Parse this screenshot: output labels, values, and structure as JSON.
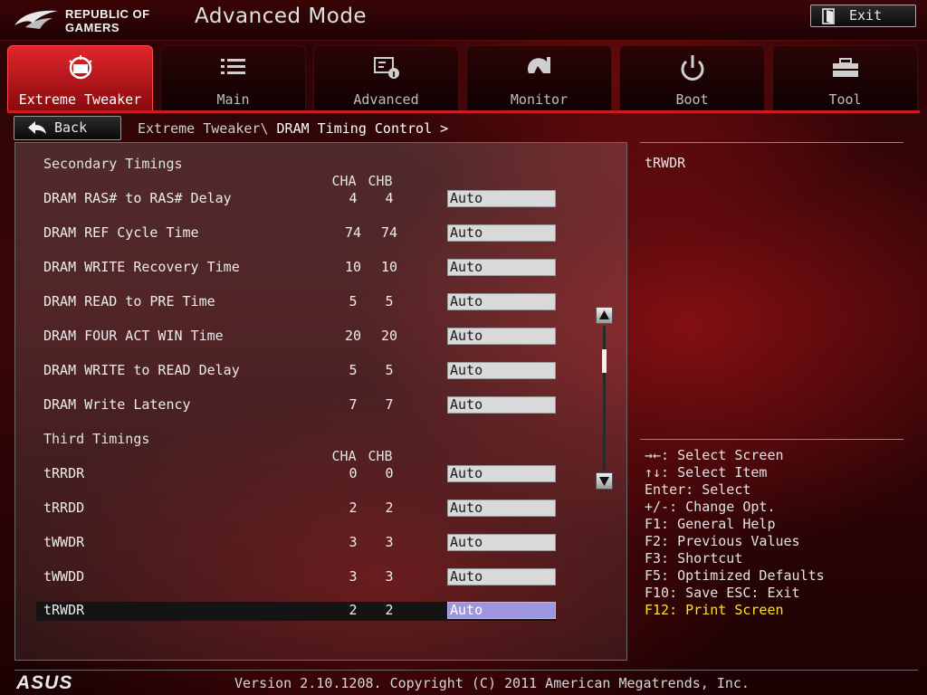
{
  "header": {
    "logo_line1": "REPUBLIC OF",
    "logo_line2": "GAMERS",
    "mode_title": "Advanced Mode",
    "exit_label": "Exit"
  },
  "tabs": [
    {
      "label": "Extreme Tweaker",
      "icon": "extreme-tweaker-icon",
      "active": true
    },
    {
      "label": "Main",
      "icon": "list-icon",
      "active": false
    },
    {
      "label": "Advanced",
      "icon": "advanced-settings-icon",
      "active": false
    },
    {
      "label": "Monitor",
      "icon": "monitor-gauge-icon",
      "active": false
    },
    {
      "label": "Boot",
      "icon": "power-icon",
      "active": false
    },
    {
      "label": "Tool",
      "icon": "toolbox-icon",
      "active": false
    }
  ],
  "nav": {
    "back_label": "Back",
    "breadcrumb_parent": "Extreme Tweaker\\",
    "breadcrumb_current": "DRAM Timing Control >"
  },
  "secondary": {
    "title": "Secondary Timings",
    "col_a": "CHA",
    "col_b": "CHB",
    "rows": [
      {
        "name": "DRAM RAS# to RAS# Delay",
        "cha": "4",
        "chb": "4",
        "value": "Auto"
      },
      {
        "name": "DRAM REF Cycle Time",
        "cha": "74",
        "chb": "74",
        "value": "Auto"
      },
      {
        "name": "DRAM WRITE Recovery Time",
        "cha": "10",
        "chb": "10",
        "value": "Auto"
      },
      {
        "name": "DRAM READ to PRE Time",
        "cha": "5",
        "chb": "5",
        "value": "Auto"
      },
      {
        "name": "DRAM FOUR ACT WIN Time",
        "cha": "20",
        "chb": "20",
        "value": "Auto"
      },
      {
        "name": "DRAM WRITE to READ Delay",
        "cha": "5",
        "chb": "5",
        "value": "Auto"
      },
      {
        "name": "DRAM Write Latency",
        "cha": "7",
        "chb": "7",
        "value": "Auto"
      }
    ]
  },
  "third": {
    "title": "Third Timings",
    "col_a": "CHA",
    "col_b": "CHB",
    "rows": [
      {
        "name": "tRRDR",
        "cha": "0",
        "chb": "0",
        "value": "Auto"
      },
      {
        "name": "tRRDD",
        "cha": "2",
        "chb": "2",
        "value": "Auto"
      },
      {
        "name": "tWWDR",
        "cha": "3",
        "chb": "3",
        "value": "Auto"
      },
      {
        "name": "tWWDD",
        "cha": "3",
        "chb": "3",
        "value": "Auto"
      },
      {
        "name": "tRWDR",
        "cha": "2",
        "chb": "2",
        "value": "Auto",
        "selected": true
      }
    ]
  },
  "help": {
    "item_title": "tRWDR",
    "keys": [
      "→←: Select Screen",
      "↑↓: Select Item",
      "Enter: Select",
      "+/-: Change Opt.",
      "F1: General Help",
      "F2: Previous Values",
      "F3: Shortcut",
      "F5: Optimized Defaults",
      "F10: Save  ESC: Exit",
      "F12: Print Screen"
    ],
    "highlight_color": "#ffe21f"
  },
  "footer": {
    "brand": "ASUS",
    "version": "Version 2.10.1208. Copyright (C) 2011 American Megatrends, Inc."
  },
  "colors": {
    "accent": "#c91b20",
    "selected_field": "#9c96e0"
  }
}
